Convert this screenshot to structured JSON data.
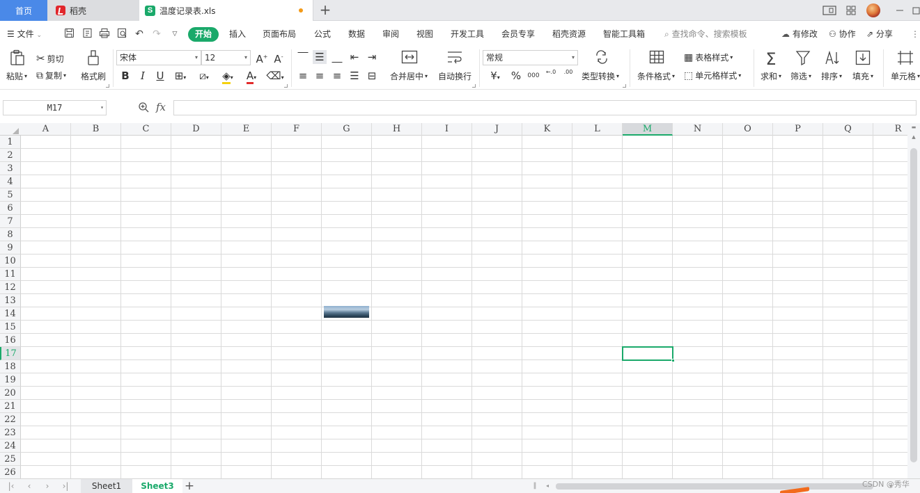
{
  "tabs": {
    "home": "首页",
    "daoke": "稻壳",
    "file": "温度记录表.xls",
    "new_tab": "+"
  },
  "window": {
    "icons": [
      "layout-icon",
      "grid-icon",
      "avatar",
      "minimize-icon",
      "restore-icon"
    ]
  },
  "menu": {
    "file": "文件",
    "start": "开始",
    "items": [
      "插入",
      "页面布局",
      "公式",
      "数据",
      "审阅",
      "视图",
      "开发工具",
      "会员专享",
      "稻壳资源",
      "智能工具箱"
    ],
    "search": "查找命令、搜索模板",
    "modified": "有修改",
    "collab": "协作",
    "share": "分享"
  },
  "ribbon": {
    "paste": "粘贴",
    "cut": "剪切",
    "copy": "复制",
    "format_painter": "格式刷",
    "font": "宋体",
    "font_size": "12",
    "merge_center": "合并居中",
    "wrap": "自动换行",
    "number_format": "常规",
    "type_convert": "类型转换",
    "cond_format": "条件格式",
    "table_style": "表格样式",
    "cell_style": "单元格样式",
    "sum": "求和",
    "filter": "筛选",
    "sort": "排序",
    "fill": "填充",
    "cell": "单元格",
    "bold": "B",
    "italic": "I",
    "underline": "U",
    "font_color": "A",
    "currency": "¥",
    "percent": "%",
    "thousands": "000",
    "inc_decimal": "←.0",
    "dec_decimal": ".00"
  },
  "formula_bar": {
    "name_box": "M17",
    "fx": "fx",
    "value": ""
  },
  "grid": {
    "columns": [
      "A",
      "B",
      "C",
      "D",
      "E",
      "F",
      "G",
      "H",
      "I",
      "J",
      "K",
      "L",
      "M",
      "N",
      "O",
      "P",
      "Q",
      "R"
    ],
    "rows": [
      "1",
      "2",
      "3",
      "4",
      "5",
      "6",
      "7",
      "8",
      "9",
      "10",
      "11",
      "12",
      "13",
      "14",
      "15",
      "16",
      "17",
      "18",
      "19",
      "20",
      "21",
      "22",
      "23",
      "24",
      "25",
      "26"
    ],
    "active_column": "M",
    "active_row": "17"
  },
  "sheets": {
    "tabs": [
      "Sheet1",
      "Sheet3"
    ],
    "active": "Sheet3",
    "add": "+"
  },
  "watermark": "CSDN @秀华",
  "colors": {
    "accent": "#1aa96a",
    "home_tab": "#4a89e8",
    "modified_dot": "#f39a18"
  }
}
